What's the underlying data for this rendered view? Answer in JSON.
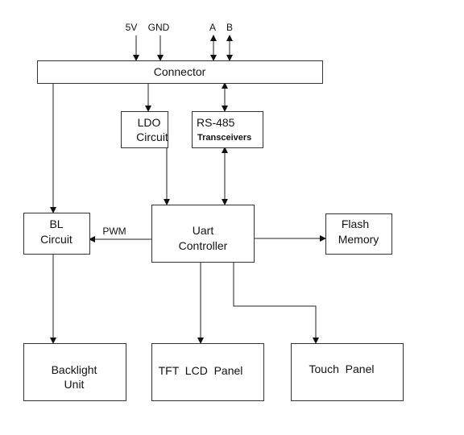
{
  "signals": {
    "v5": "5V",
    "gnd": "GND",
    "a": "A",
    "b": "B",
    "pwm": "PWM"
  },
  "blocks": {
    "connector": "Connector",
    "ldo": [
      "LDO",
      "Circuit"
    ],
    "rs485": [
      "RS-485",
      "Transceivers"
    ],
    "bl": [
      "BL",
      "Circuit"
    ],
    "uart": [
      "Uart",
      "Controller"
    ],
    "flash": [
      "Flash",
      "Memory"
    ],
    "backlight": [
      "Backlight",
      "Unit"
    ],
    "tft": "TFT  LCD  Panel",
    "touch": "Touch  Panel"
  }
}
